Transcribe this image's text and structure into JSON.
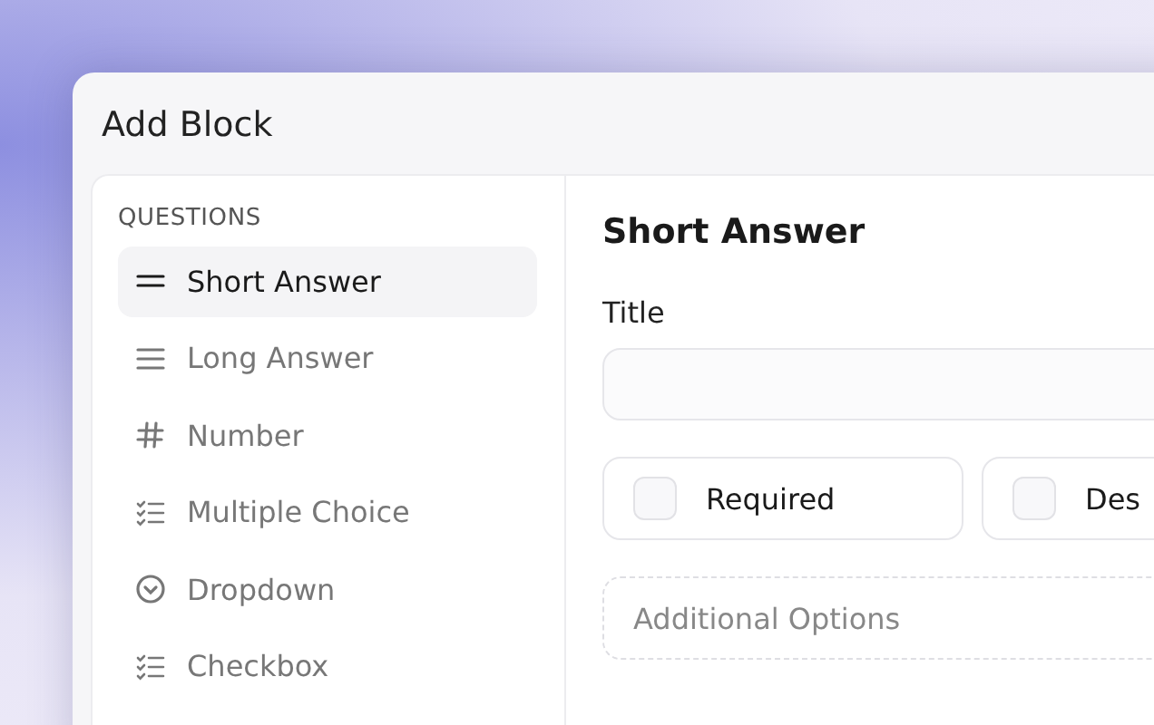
{
  "window": {
    "title": "Add Block"
  },
  "sidebar": {
    "heading": "QUESTIONS",
    "items": [
      {
        "label": "Short Answer",
        "kind": "short",
        "selected": true
      },
      {
        "label": "Long Answer",
        "kind": "long",
        "selected": false
      },
      {
        "label": "Number",
        "kind": "number",
        "selected": false
      },
      {
        "label": "Multiple Choice",
        "kind": "choice",
        "selected": false
      },
      {
        "label": "Dropdown",
        "kind": "dropdown",
        "selected": false
      },
      {
        "label": "Checkbox",
        "kind": "choice",
        "selected": false
      }
    ]
  },
  "editor": {
    "heading": "Short Answer",
    "title_label": "Title",
    "options": [
      {
        "label": "Required",
        "checked": false
      },
      {
        "label": "Des",
        "checked": false
      }
    ],
    "additional": {
      "label": "Additional Options"
    }
  }
}
